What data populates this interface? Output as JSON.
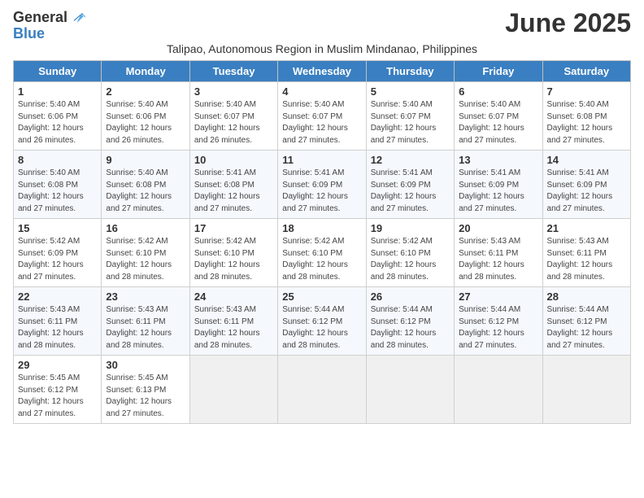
{
  "header": {
    "logo_general": "General",
    "logo_blue": "Blue",
    "month_title": "June 2025",
    "subtitle": "Talipao, Autonomous Region in Muslim Mindanao, Philippines"
  },
  "weekdays": [
    "Sunday",
    "Monday",
    "Tuesday",
    "Wednesday",
    "Thursday",
    "Friday",
    "Saturday"
  ],
  "weeks": [
    [
      {
        "day": "1",
        "lines": [
          "Sunrise: 5:40 AM",
          "Sunset: 6:06 PM",
          "Daylight: 12 hours",
          "and 26 minutes."
        ]
      },
      {
        "day": "2",
        "lines": [
          "Sunrise: 5:40 AM",
          "Sunset: 6:06 PM",
          "Daylight: 12 hours",
          "and 26 minutes."
        ]
      },
      {
        "day": "3",
        "lines": [
          "Sunrise: 5:40 AM",
          "Sunset: 6:07 PM",
          "Daylight: 12 hours",
          "and 26 minutes."
        ]
      },
      {
        "day": "4",
        "lines": [
          "Sunrise: 5:40 AM",
          "Sunset: 6:07 PM",
          "Daylight: 12 hours",
          "and 27 minutes."
        ]
      },
      {
        "day": "5",
        "lines": [
          "Sunrise: 5:40 AM",
          "Sunset: 6:07 PM",
          "Daylight: 12 hours",
          "and 27 minutes."
        ]
      },
      {
        "day": "6",
        "lines": [
          "Sunrise: 5:40 AM",
          "Sunset: 6:07 PM",
          "Daylight: 12 hours",
          "and 27 minutes."
        ]
      },
      {
        "day": "7",
        "lines": [
          "Sunrise: 5:40 AM",
          "Sunset: 6:08 PM",
          "Daylight: 12 hours",
          "and 27 minutes."
        ]
      }
    ],
    [
      {
        "day": "8",
        "lines": [
          "Sunrise: 5:40 AM",
          "Sunset: 6:08 PM",
          "Daylight: 12 hours",
          "and 27 minutes."
        ]
      },
      {
        "day": "9",
        "lines": [
          "Sunrise: 5:40 AM",
          "Sunset: 6:08 PM",
          "Daylight: 12 hours",
          "and 27 minutes."
        ]
      },
      {
        "day": "10",
        "lines": [
          "Sunrise: 5:41 AM",
          "Sunset: 6:08 PM",
          "Daylight: 12 hours",
          "and 27 minutes."
        ]
      },
      {
        "day": "11",
        "lines": [
          "Sunrise: 5:41 AM",
          "Sunset: 6:09 PM",
          "Daylight: 12 hours",
          "and 27 minutes."
        ]
      },
      {
        "day": "12",
        "lines": [
          "Sunrise: 5:41 AM",
          "Sunset: 6:09 PM",
          "Daylight: 12 hours",
          "and 27 minutes."
        ]
      },
      {
        "day": "13",
        "lines": [
          "Sunrise: 5:41 AM",
          "Sunset: 6:09 PM",
          "Daylight: 12 hours",
          "and 27 minutes."
        ]
      },
      {
        "day": "14",
        "lines": [
          "Sunrise: 5:41 AM",
          "Sunset: 6:09 PM",
          "Daylight: 12 hours",
          "and 27 minutes."
        ]
      }
    ],
    [
      {
        "day": "15",
        "lines": [
          "Sunrise: 5:42 AM",
          "Sunset: 6:09 PM",
          "Daylight: 12 hours",
          "and 27 minutes."
        ]
      },
      {
        "day": "16",
        "lines": [
          "Sunrise: 5:42 AM",
          "Sunset: 6:10 PM",
          "Daylight: 12 hours",
          "and 28 minutes."
        ]
      },
      {
        "day": "17",
        "lines": [
          "Sunrise: 5:42 AM",
          "Sunset: 6:10 PM",
          "Daylight: 12 hours",
          "and 28 minutes."
        ]
      },
      {
        "day": "18",
        "lines": [
          "Sunrise: 5:42 AM",
          "Sunset: 6:10 PM",
          "Daylight: 12 hours",
          "and 28 minutes."
        ]
      },
      {
        "day": "19",
        "lines": [
          "Sunrise: 5:42 AM",
          "Sunset: 6:10 PM",
          "Daylight: 12 hours",
          "and 28 minutes."
        ]
      },
      {
        "day": "20",
        "lines": [
          "Sunrise: 5:43 AM",
          "Sunset: 6:11 PM",
          "Daylight: 12 hours",
          "and 28 minutes."
        ]
      },
      {
        "day": "21",
        "lines": [
          "Sunrise: 5:43 AM",
          "Sunset: 6:11 PM",
          "Daylight: 12 hours",
          "and 28 minutes."
        ]
      }
    ],
    [
      {
        "day": "22",
        "lines": [
          "Sunrise: 5:43 AM",
          "Sunset: 6:11 PM",
          "Daylight: 12 hours",
          "and 28 minutes."
        ]
      },
      {
        "day": "23",
        "lines": [
          "Sunrise: 5:43 AM",
          "Sunset: 6:11 PM",
          "Daylight: 12 hours",
          "and 28 minutes."
        ]
      },
      {
        "day": "24",
        "lines": [
          "Sunrise: 5:43 AM",
          "Sunset: 6:11 PM",
          "Daylight: 12 hours",
          "and 28 minutes."
        ]
      },
      {
        "day": "25",
        "lines": [
          "Sunrise: 5:44 AM",
          "Sunset: 6:12 PM",
          "Daylight: 12 hours",
          "and 28 minutes."
        ]
      },
      {
        "day": "26",
        "lines": [
          "Sunrise: 5:44 AM",
          "Sunset: 6:12 PM",
          "Daylight: 12 hours",
          "and 28 minutes."
        ]
      },
      {
        "day": "27",
        "lines": [
          "Sunrise: 5:44 AM",
          "Sunset: 6:12 PM",
          "Daylight: 12 hours",
          "and 27 minutes."
        ]
      },
      {
        "day": "28",
        "lines": [
          "Sunrise: 5:44 AM",
          "Sunset: 6:12 PM",
          "Daylight: 12 hours",
          "and 27 minutes."
        ]
      }
    ],
    [
      {
        "day": "29",
        "lines": [
          "Sunrise: 5:45 AM",
          "Sunset: 6:12 PM",
          "Daylight: 12 hours",
          "and 27 minutes."
        ]
      },
      {
        "day": "30",
        "lines": [
          "Sunrise: 5:45 AM",
          "Sunset: 6:13 PM",
          "Daylight: 12 hours",
          "and 27 minutes."
        ]
      },
      {
        "day": "",
        "lines": []
      },
      {
        "day": "",
        "lines": []
      },
      {
        "day": "",
        "lines": []
      },
      {
        "day": "",
        "lines": []
      },
      {
        "day": "",
        "lines": []
      }
    ]
  ]
}
